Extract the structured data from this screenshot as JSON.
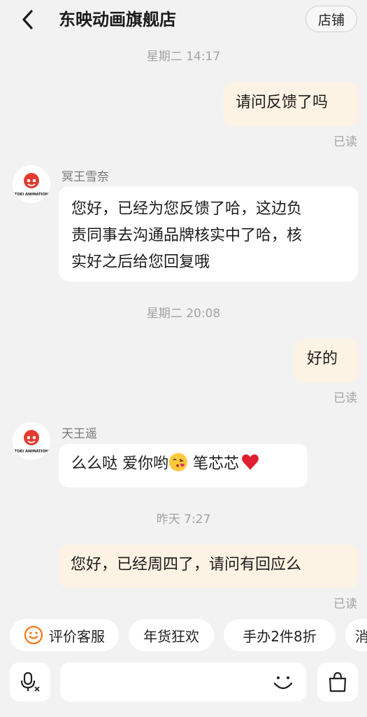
{
  "header": {
    "title": "东映动画旗舰店",
    "store_label": "店铺"
  },
  "messages": [
    {
      "type": "time",
      "text": "星期二 14:17"
    },
    {
      "type": "out",
      "text": "请问反馈了吗",
      "status": "已读"
    },
    {
      "type": "in",
      "sender": "冥王雪奈",
      "lines": [
        "您好，已经为您反馈了哈，这边负",
        "责同事去沟通品牌核实中了哈，核",
        "实好之后给您回复哦"
      ]
    },
    {
      "type": "time",
      "text": "星期二 20:08"
    },
    {
      "type": "out",
      "text": "好的",
      "status": "已读"
    },
    {
      "type": "in",
      "sender": "天王遥",
      "text_a": "么么哒 爱你哟",
      "text_b": " 笔芯芯"
    },
    {
      "type": "time",
      "text": "昨天 7:27"
    },
    {
      "type": "out",
      "text": "您好，已经周四了，请问有回应么",
      "status": "已读"
    }
  ],
  "avatar_logo_text": "TOEI ANIMATION",
  "quick_replies": [
    "评价客服",
    "年货狂欢",
    "手办2件8折",
    "消"
  ],
  "icons": {
    "back": "chevron-left-icon",
    "voice": "microphone-icon",
    "emoji": "smile-icon",
    "shop": "shopping-bag-icon"
  },
  "colors": {
    "outgoing_bubble": "#fdf3e4",
    "incoming_bubble": "#ffffff",
    "background": "#f2f2f2",
    "accent_orange": "#ff6a00"
  }
}
